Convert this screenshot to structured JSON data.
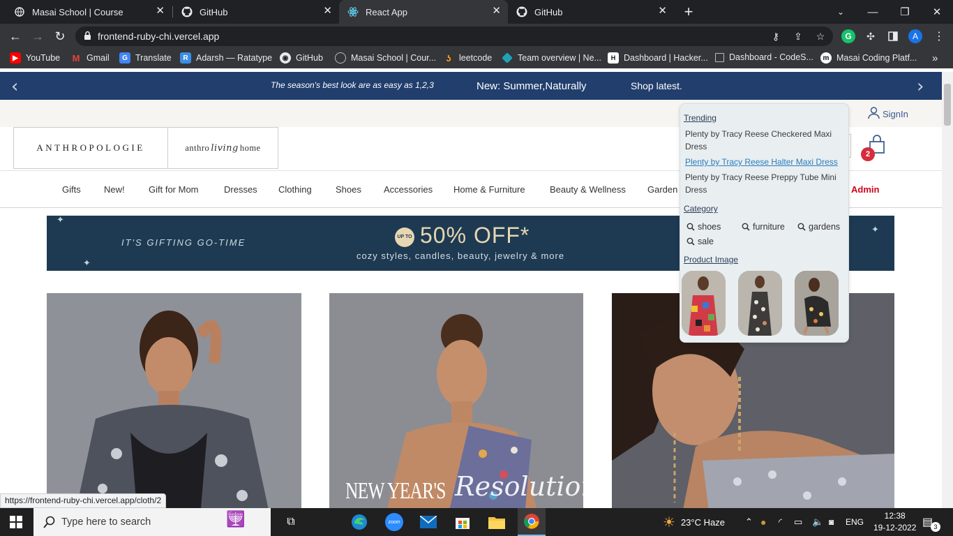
{
  "browser": {
    "tabs": [
      {
        "title": "Masai School | Course",
        "icon": "globe-icon",
        "active": false
      },
      {
        "title": "GitHub",
        "icon": "github-icon",
        "active": false
      },
      {
        "title": "React App",
        "icon": "react-icon",
        "active": true
      },
      {
        "title": "GitHub",
        "icon": "github-icon",
        "active": false
      }
    ],
    "new_tab": "+",
    "url": "frontend-ruby-chi.vercel.app",
    "profile_initial": "A",
    "extension_initial": "G",
    "bookmarks": [
      {
        "label": "YouTube",
        "icon": "youtube-icon",
        "color": "#ff0000"
      },
      {
        "label": "Gmail",
        "icon": "gmail-icon",
        "color": "#ea4335"
      },
      {
        "label": "Translate",
        "icon": "translate-icon",
        "color": "#4285f4"
      },
      {
        "label": "Adarsh — Ratatype",
        "icon": "ratatype-icon",
        "color": "#3a8ee6"
      },
      {
        "label": "GitHub",
        "icon": "github-icon",
        "color": "#ffffff"
      },
      {
        "label": "Masai School | Cour...",
        "icon": "globe-icon",
        "color": "#bbbbbb"
      },
      {
        "label": "leetcode",
        "icon": "leetcode-icon",
        "color": "#ffa116"
      },
      {
        "label": "Team overview | Ne...",
        "icon": "diamond-icon",
        "color": "#1fa3b5"
      },
      {
        "label": "Dashboard | Hacker...",
        "icon": "hackerrank-icon",
        "color": "#111111"
      },
      {
        "label": "Dashboard - CodeS...",
        "icon": "page-icon",
        "color": "#bbbbbb"
      },
      {
        "label": "Masai Coding Platf...",
        "icon": "masai-icon",
        "color": "#ffffff"
      }
    ],
    "status_url": "https://frontend-ruby-chi.vercel.app/cloth/2"
  },
  "site": {
    "promo": {
      "left": "The season's best look are as easy as 1,2,3",
      "center": "New: Summer,Naturally",
      "right": "Shop latest."
    },
    "signin": "SignIn",
    "logo_main": "ANTHROPOLOGIE",
    "logo_home_a": "anthro",
    "logo_home_b": "living",
    "logo_home_c": "home",
    "cart_count": "2",
    "nav": [
      "Gifts",
      "New!",
      "Gift for Mom",
      "Dresses",
      "Clothing",
      "Shoes",
      "Accessories",
      "Home & Furniture",
      "Beauty & Wellness",
      "Garden",
      "Admin"
    ],
    "banner": {
      "left": "IT'S GIFTING GO-TIME",
      "badge": "UP TO",
      "headline": "50% OFF*",
      "sub": "cozy styles, candles, beauty, jewelry & more"
    },
    "photo_overlay_a": "NEW YEAR'S",
    "photo_overlay_b": "Resolutions"
  },
  "dropdown": {
    "trending_heading": "Trending",
    "trending": [
      "Plenty by Tracy Reese Checkered Maxi Dress",
      "Plenty by Tracy Reese Halter Maxi Dress",
      "Plenty by Tracy Reese Preppy Tube Mini Dress"
    ],
    "category_heading": "Category",
    "categories": [
      "shoes",
      "furniture",
      "gardens",
      "sale"
    ],
    "image_heading": "Product Image"
  },
  "taskbar": {
    "search_placeholder": "Type here to search",
    "weather": "23°C  Haze",
    "language": "ENG",
    "time": "12:38",
    "date": "19-12-2022",
    "notifications": "3"
  }
}
